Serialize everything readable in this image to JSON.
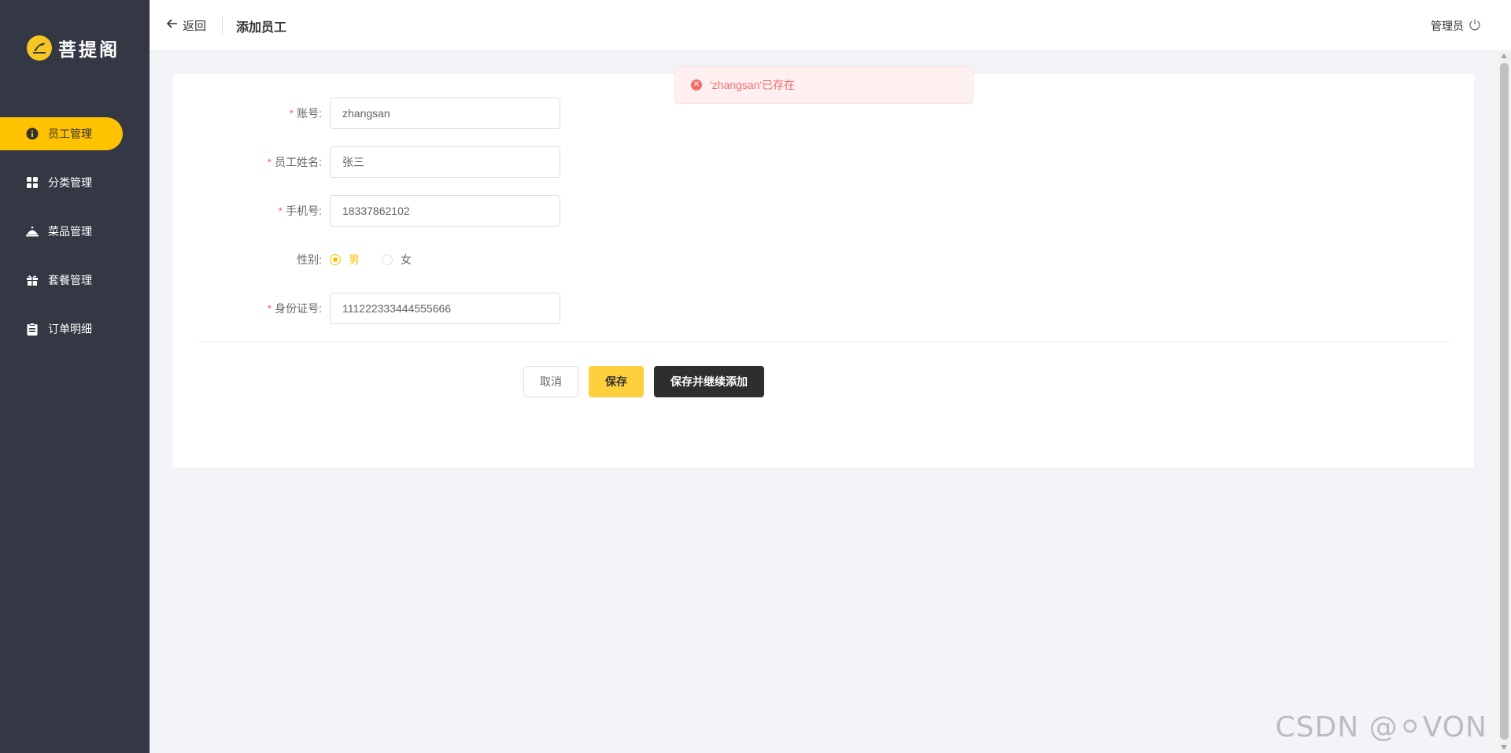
{
  "app": {
    "brand": "菩提阁"
  },
  "sidebar": {
    "items": [
      {
        "label": "员工管理",
        "icon": "info-circle-icon",
        "active": true
      },
      {
        "label": "分类管理",
        "icon": "grid-icon",
        "active": false
      },
      {
        "label": "菜品管理",
        "icon": "dish-cover-icon",
        "active": false
      },
      {
        "label": "套餐管理",
        "icon": "gift-icon",
        "active": false
      },
      {
        "label": "订单明细",
        "icon": "clipboard-icon",
        "active": false
      }
    ]
  },
  "header": {
    "back_label": "返回",
    "title": "添加员工",
    "user": "管理员"
  },
  "toast": {
    "message": "'zhangsan'已存在",
    "type": "error"
  },
  "form": {
    "account": {
      "label": "账号:",
      "value": "zhangsan"
    },
    "name": {
      "label": "员工姓名:",
      "value": "张三"
    },
    "phone": {
      "label": "手机号:",
      "value": "18337862102"
    },
    "gender": {
      "label": "性别:",
      "options": [
        "男",
        "女"
      ],
      "selected": "男"
    },
    "id_number": {
      "label": "身份证号:",
      "value": "111222333444555666"
    },
    "required_mark": "*"
  },
  "buttons": {
    "cancel": "取消",
    "save": "保存",
    "save_and_add": "保存并继续添加"
  },
  "watermark": "CSDN @⚪VON",
  "colors": {
    "sidebar_bg": "#343744",
    "accent": "#ffc200",
    "error": "#f56c6c",
    "dark_button": "#2e2e2e"
  }
}
